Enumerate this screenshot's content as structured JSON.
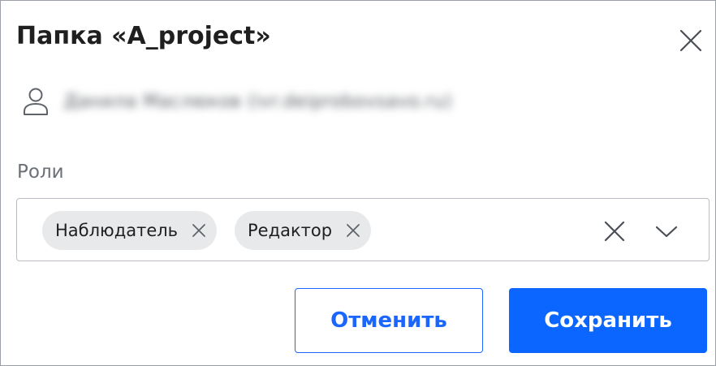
{
  "dialog": {
    "title": "Папка «A_project»"
  },
  "user": {
    "name": "Данила Маслюков (ivr.deiprobovsavo.ru)"
  },
  "roles": {
    "label": "Роли",
    "selected": [
      {
        "label": "Наблюдатель"
      },
      {
        "label": "Редактор"
      }
    ]
  },
  "buttons": {
    "cancel_label": "Отменить",
    "save_label": "Сохранить"
  },
  "colors": {
    "accent": "#0b66ff",
    "chip_background": "#e8e9eb",
    "border": "#b9bec5"
  },
  "icons": {
    "close": "close-icon",
    "user": "user-icon",
    "chip_remove": "remove-icon",
    "clear_all": "clear-icon",
    "dropdown": "chevron-down-icon"
  }
}
